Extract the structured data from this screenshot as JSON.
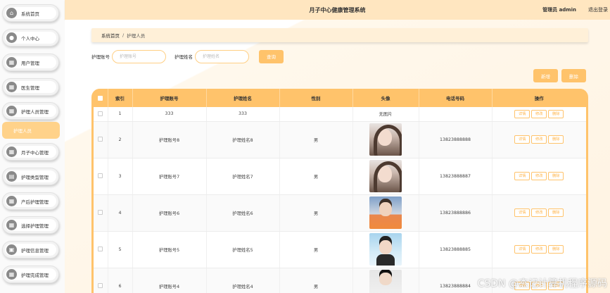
{
  "header": {
    "title": "月子中心健康管理系统",
    "user": "管理员 admin",
    "logout": "退出登录"
  },
  "sidebar": {
    "items": [
      {
        "label": "系统首页",
        "icon": "home-icon",
        "glyph": "⌂"
      },
      {
        "label": "个人中心",
        "icon": "user-icon",
        "glyph": "●"
      },
      {
        "label": "用户管理",
        "icon": "grid-icon",
        "glyph": "▦"
      },
      {
        "label": "医生管理",
        "icon": "grid-icon",
        "glyph": "▦"
      },
      {
        "label": "护理人员管理",
        "icon": "grid-icon",
        "glyph": "▦"
      },
      {
        "label": "月子中心管理",
        "icon": "grid-icon",
        "glyph": "▦"
      },
      {
        "label": "护理类型管理",
        "icon": "folder-icon",
        "glyph": "▤"
      },
      {
        "label": "产后护理管理",
        "icon": "grid-icon",
        "glyph": "▦"
      },
      {
        "label": "选择护理管理",
        "icon": "grid-icon",
        "glyph": "▦"
      },
      {
        "label": "护理信息管理",
        "icon": "lock-icon",
        "glyph": "▣"
      },
      {
        "label": "护理完成管理",
        "icon": "grid-icon",
        "glyph": "▦"
      }
    ],
    "active_sub": "护理人员"
  },
  "breadcrumb": {
    "home": "系统首页",
    "sep": "/",
    "current": "护理人员"
  },
  "search": {
    "account_label": "护理账号",
    "account_placeholder": "护理账号",
    "name_label": "护理姓名",
    "name_placeholder": "护理姓名",
    "button": "查询"
  },
  "actions": {
    "add": "新增",
    "delete": "删除"
  },
  "table": {
    "headers": [
      "",
      "索引",
      "护理账号",
      "护理姓名",
      "性别",
      "头像",
      "电话号码",
      "操作"
    ],
    "ops": [
      "详情",
      "修改",
      "删除"
    ],
    "rows": [
      {
        "index": "1",
        "account": "333",
        "name": "333",
        "gender": "",
        "avatar_text": "无图片",
        "avatar": "",
        "phone": ""
      },
      {
        "index": "2",
        "account": "护理账号8",
        "name": "护理姓名8",
        "gender": "男",
        "avatar_text": "",
        "avatar": "av-girl",
        "phone": "13823888888"
      },
      {
        "index": "3",
        "account": "护理账号7",
        "name": "护理姓名7",
        "gender": "男",
        "avatar_text": "",
        "avatar": "av-girl",
        "phone": "13823888887"
      },
      {
        "index": "4",
        "account": "护理账号6",
        "name": "护理姓名6",
        "gender": "男",
        "avatar_text": "",
        "avatar": "av-boy1",
        "phone": "13823888886"
      },
      {
        "index": "5",
        "account": "护理账号5",
        "name": "护理姓名5",
        "gender": "男",
        "avatar_text": "",
        "avatar": "av-boy2",
        "phone": "13823888885"
      },
      {
        "index": "6",
        "account": "护理账号4",
        "name": "护理姓名4",
        "gender": "男",
        "avatar_text": "",
        "avatar": "av-boy3",
        "phone": "13823888884"
      }
    ]
  },
  "watermark": "CSDN @杰记计算机程序源码"
}
